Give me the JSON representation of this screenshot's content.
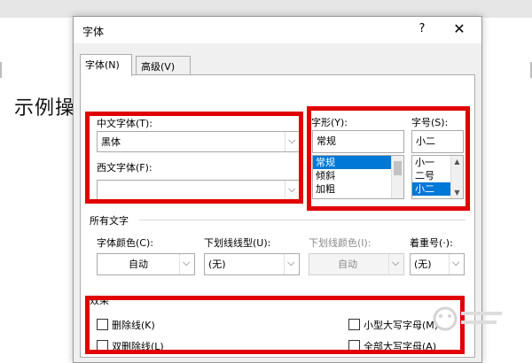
{
  "document": {
    "sample_text": "示例操"
  },
  "dialog": {
    "title": "字体",
    "help": "?",
    "close": "✕",
    "tabs": [
      {
        "label": "字体(N)"
      },
      {
        "label": "高级(V)"
      }
    ]
  },
  "font_panel": {
    "chinese_font": {
      "label": "中文字体(T):",
      "value": "黑体"
    },
    "western_font": {
      "label": "西文字体(F):",
      "value": ""
    },
    "style": {
      "label": "字形(Y):",
      "value": "常规",
      "items": [
        "常规",
        "倾斜",
        "加粗"
      ],
      "selected": "常规"
    },
    "size": {
      "label": "字号(S):",
      "value": "小二",
      "items": [
        "小一",
        "二号",
        "小二"
      ],
      "selected": "小二"
    },
    "all_text": {
      "heading": "所有文字",
      "font_color": {
        "label": "字体颜色(C):",
        "value": "自动"
      },
      "underline_style": {
        "label": "下划线线型(U):",
        "value": "(无)"
      },
      "underline_color": {
        "label": "下划线颜色(I):",
        "value": "自动"
      },
      "emphasis": {
        "label": "着重号(·):",
        "value": "(无)"
      }
    },
    "effects": {
      "heading": "效果",
      "strikethrough": "删除线(K)",
      "double_strikethrough": "双删除线(L)",
      "small_caps": "小型大写字母(M)",
      "all_caps": "全部大写字母(A)"
    }
  },
  "colors": {
    "highlight": "#e00000",
    "selection": "#0078d7"
  }
}
